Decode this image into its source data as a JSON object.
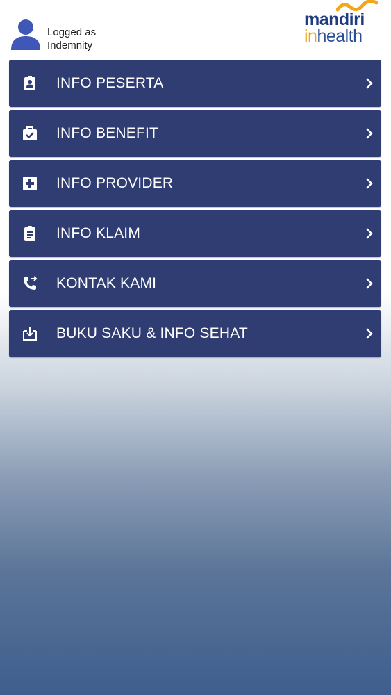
{
  "header": {
    "login_line1": "Logged as",
    "login_line2": "Indemnity",
    "logo_top": "mandiri",
    "logo_bottom_in": "in",
    "logo_bottom_rest": "health"
  },
  "menu": {
    "items": [
      {
        "label": "INFO PESERTA",
        "icon": "id-badge-icon"
      },
      {
        "label": "INFO BENEFIT",
        "icon": "medical-bag-check-icon"
      },
      {
        "label": "INFO PROVIDER",
        "icon": "hospital-plus-icon"
      },
      {
        "label": "INFO KLAIM",
        "icon": "clipboard-list-icon"
      },
      {
        "label": "KONTAK KAMI",
        "icon": "phone-forward-icon"
      },
      {
        "label": "BUKU SAKU & INFO SEHAT",
        "icon": "download-tray-icon"
      }
    ]
  },
  "colors": {
    "menu_bg": "#2f3d72",
    "avatar": "#3f57b6",
    "logo_blue": "#1f3c80",
    "logo_orange": "#f2a71b"
  }
}
